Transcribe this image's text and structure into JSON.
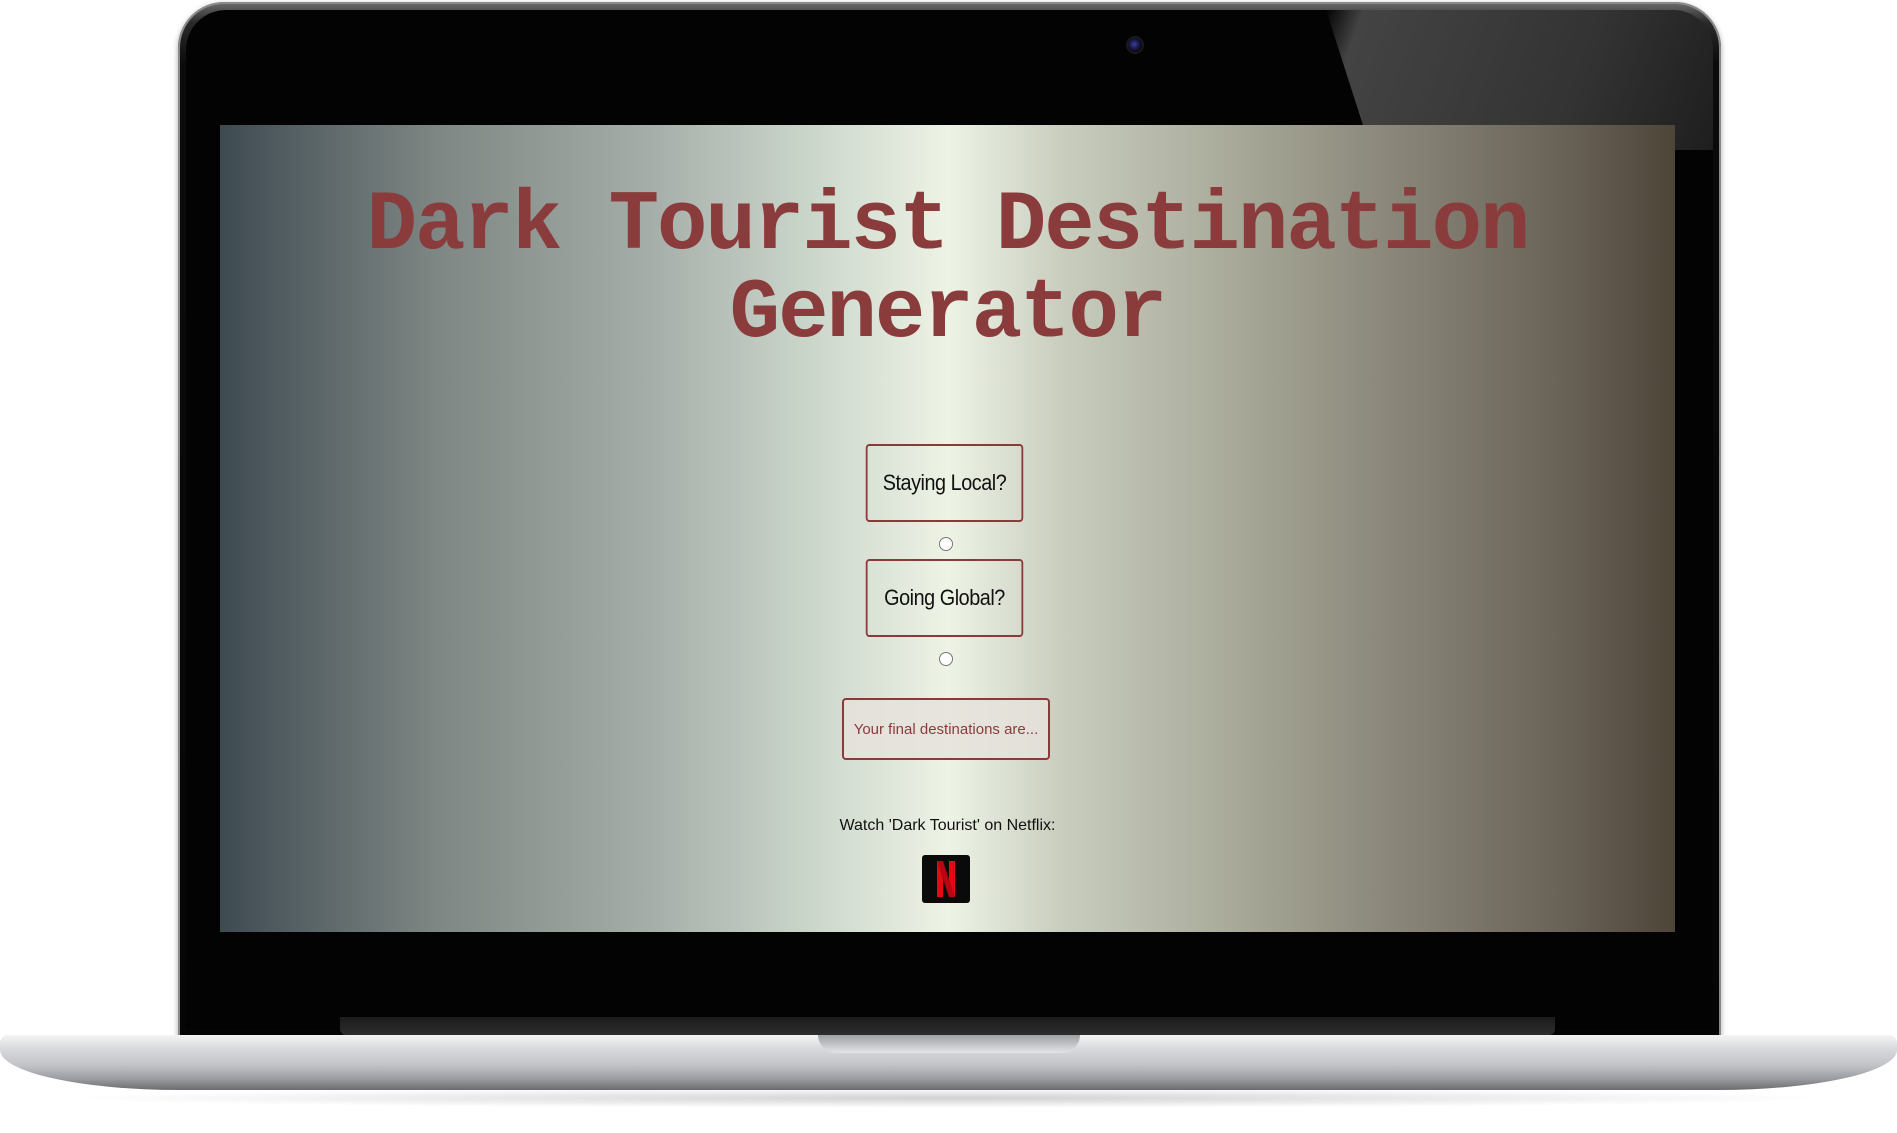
{
  "app": {
    "title": "Dark Tourist Destination Generator",
    "title_line1": "Dark Tourist Destination",
    "title_line2": "Generator"
  },
  "options": {
    "local_label": "Staying Local?",
    "global_label": "Going Global?",
    "local_selected": false,
    "global_selected": false
  },
  "result_button_label": "Your final destinations are...",
  "netflix": {
    "caption": "Watch 'Dark Tourist' on Netflix:",
    "icon": "netflix-logo-icon",
    "brand_color": "#E50914"
  },
  "colors": {
    "accent": "#8A3B3B",
    "text": "#111111"
  }
}
